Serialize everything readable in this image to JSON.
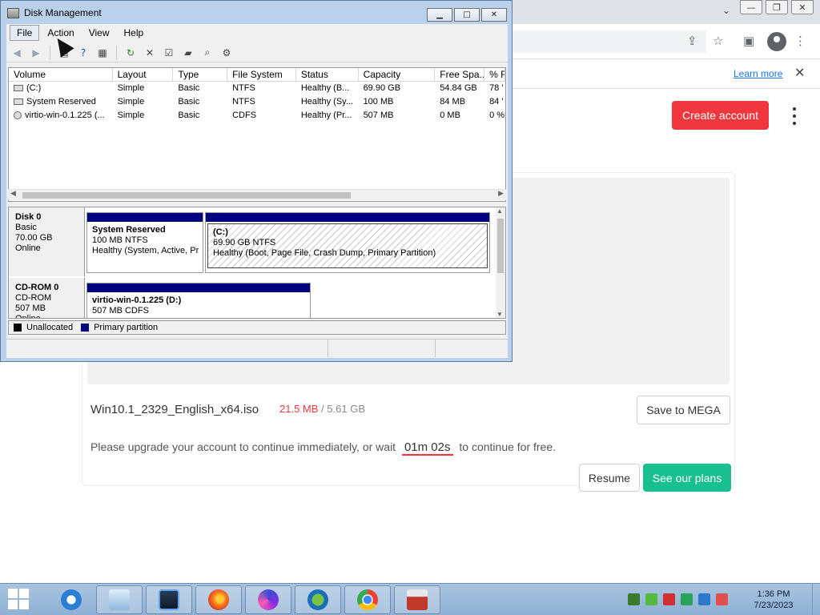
{
  "browser": {
    "learn_more": "Learn more",
    "create_account": "Create account",
    "file_name": "Win10.1_2329_English_x64.iso",
    "downloaded": "21.5 MB",
    "separator": "/",
    "total_size": "5.61 GB",
    "save_to_mega": "Save to MEGA",
    "upgrade_prefix": "Please upgrade your account to continue immediately, or wait",
    "wait_time": "01m 02s",
    "upgrade_suffix": "to continue for free.",
    "resume": "Resume",
    "see_plans": "See our plans"
  },
  "disk_mgmt": {
    "title": "Disk Management",
    "menu": [
      "File",
      "Action",
      "View",
      "Help"
    ],
    "columns": [
      "Volume",
      "Layout",
      "Type",
      "File System",
      "Status",
      "Capacity",
      "Free Spa...",
      "% F"
    ],
    "rows": [
      [
        "(C:)",
        "Simple",
        "Basic",
        "NTFS",
        "Healthy (B...",
        "69.90 GB",
        "54.84 GB",
        "78 '"
      ],
      [
        "System Reserved",
        "Simple",
        "Basic",
        "NTFS",
        "Healthy (Sy...",
        "100 MB",
        "84 MB",
        "84 '"
      ],
      [
        "virtio-win-0.1.225 (...",
        "Simple",
        "Basic",
        "CDFS",
        "Healthy (Pr...",
        "507 MB",
        "0 MB",
        "0 %"
      ]
    ],
    "disks": [
      {
        "name": "Disk 0",
        "type": "Basic",
        "size": "70.00 GB",
        "state": "Online",
        "partitions": [
          {
            "name": "System Reserved",
            "size": "100 MB NTFS",
            "status": "Healthy (System, Active, Pr"
          },
          {
            "name": "(C:)",
            "size": "69.90 GB NTFS",
            "status": "Healthy (Boot, Page File, Crash Dump, Primary Partition)"
          }
        ]
      },
      {
        "name": "CD-ROM 0",
        "type": "CD-ROM",
        "size": "507 MB",
        "state": "Online",
        "partitions": [
          {
            "name": "virtio-win-0.1.225  (D:)",
            "size": "507 MB CDFS"
          }
        ]
      }
    ],
    "legend": [
      "Unallocated",
      "Primary partition"
    ],
    "colors": {
      "unallocated": "#000000",
      "primary": "#000080"
    }
  },
  "taskbar": {
    "time": "1:36 PM",
    "date": "7/23/2023"
  },
  "colors": {
    "mega_red": "#f0373d",
    "mega_green": "#18c08f",
    "window_frame": "#b9d1ea"
  }
}
